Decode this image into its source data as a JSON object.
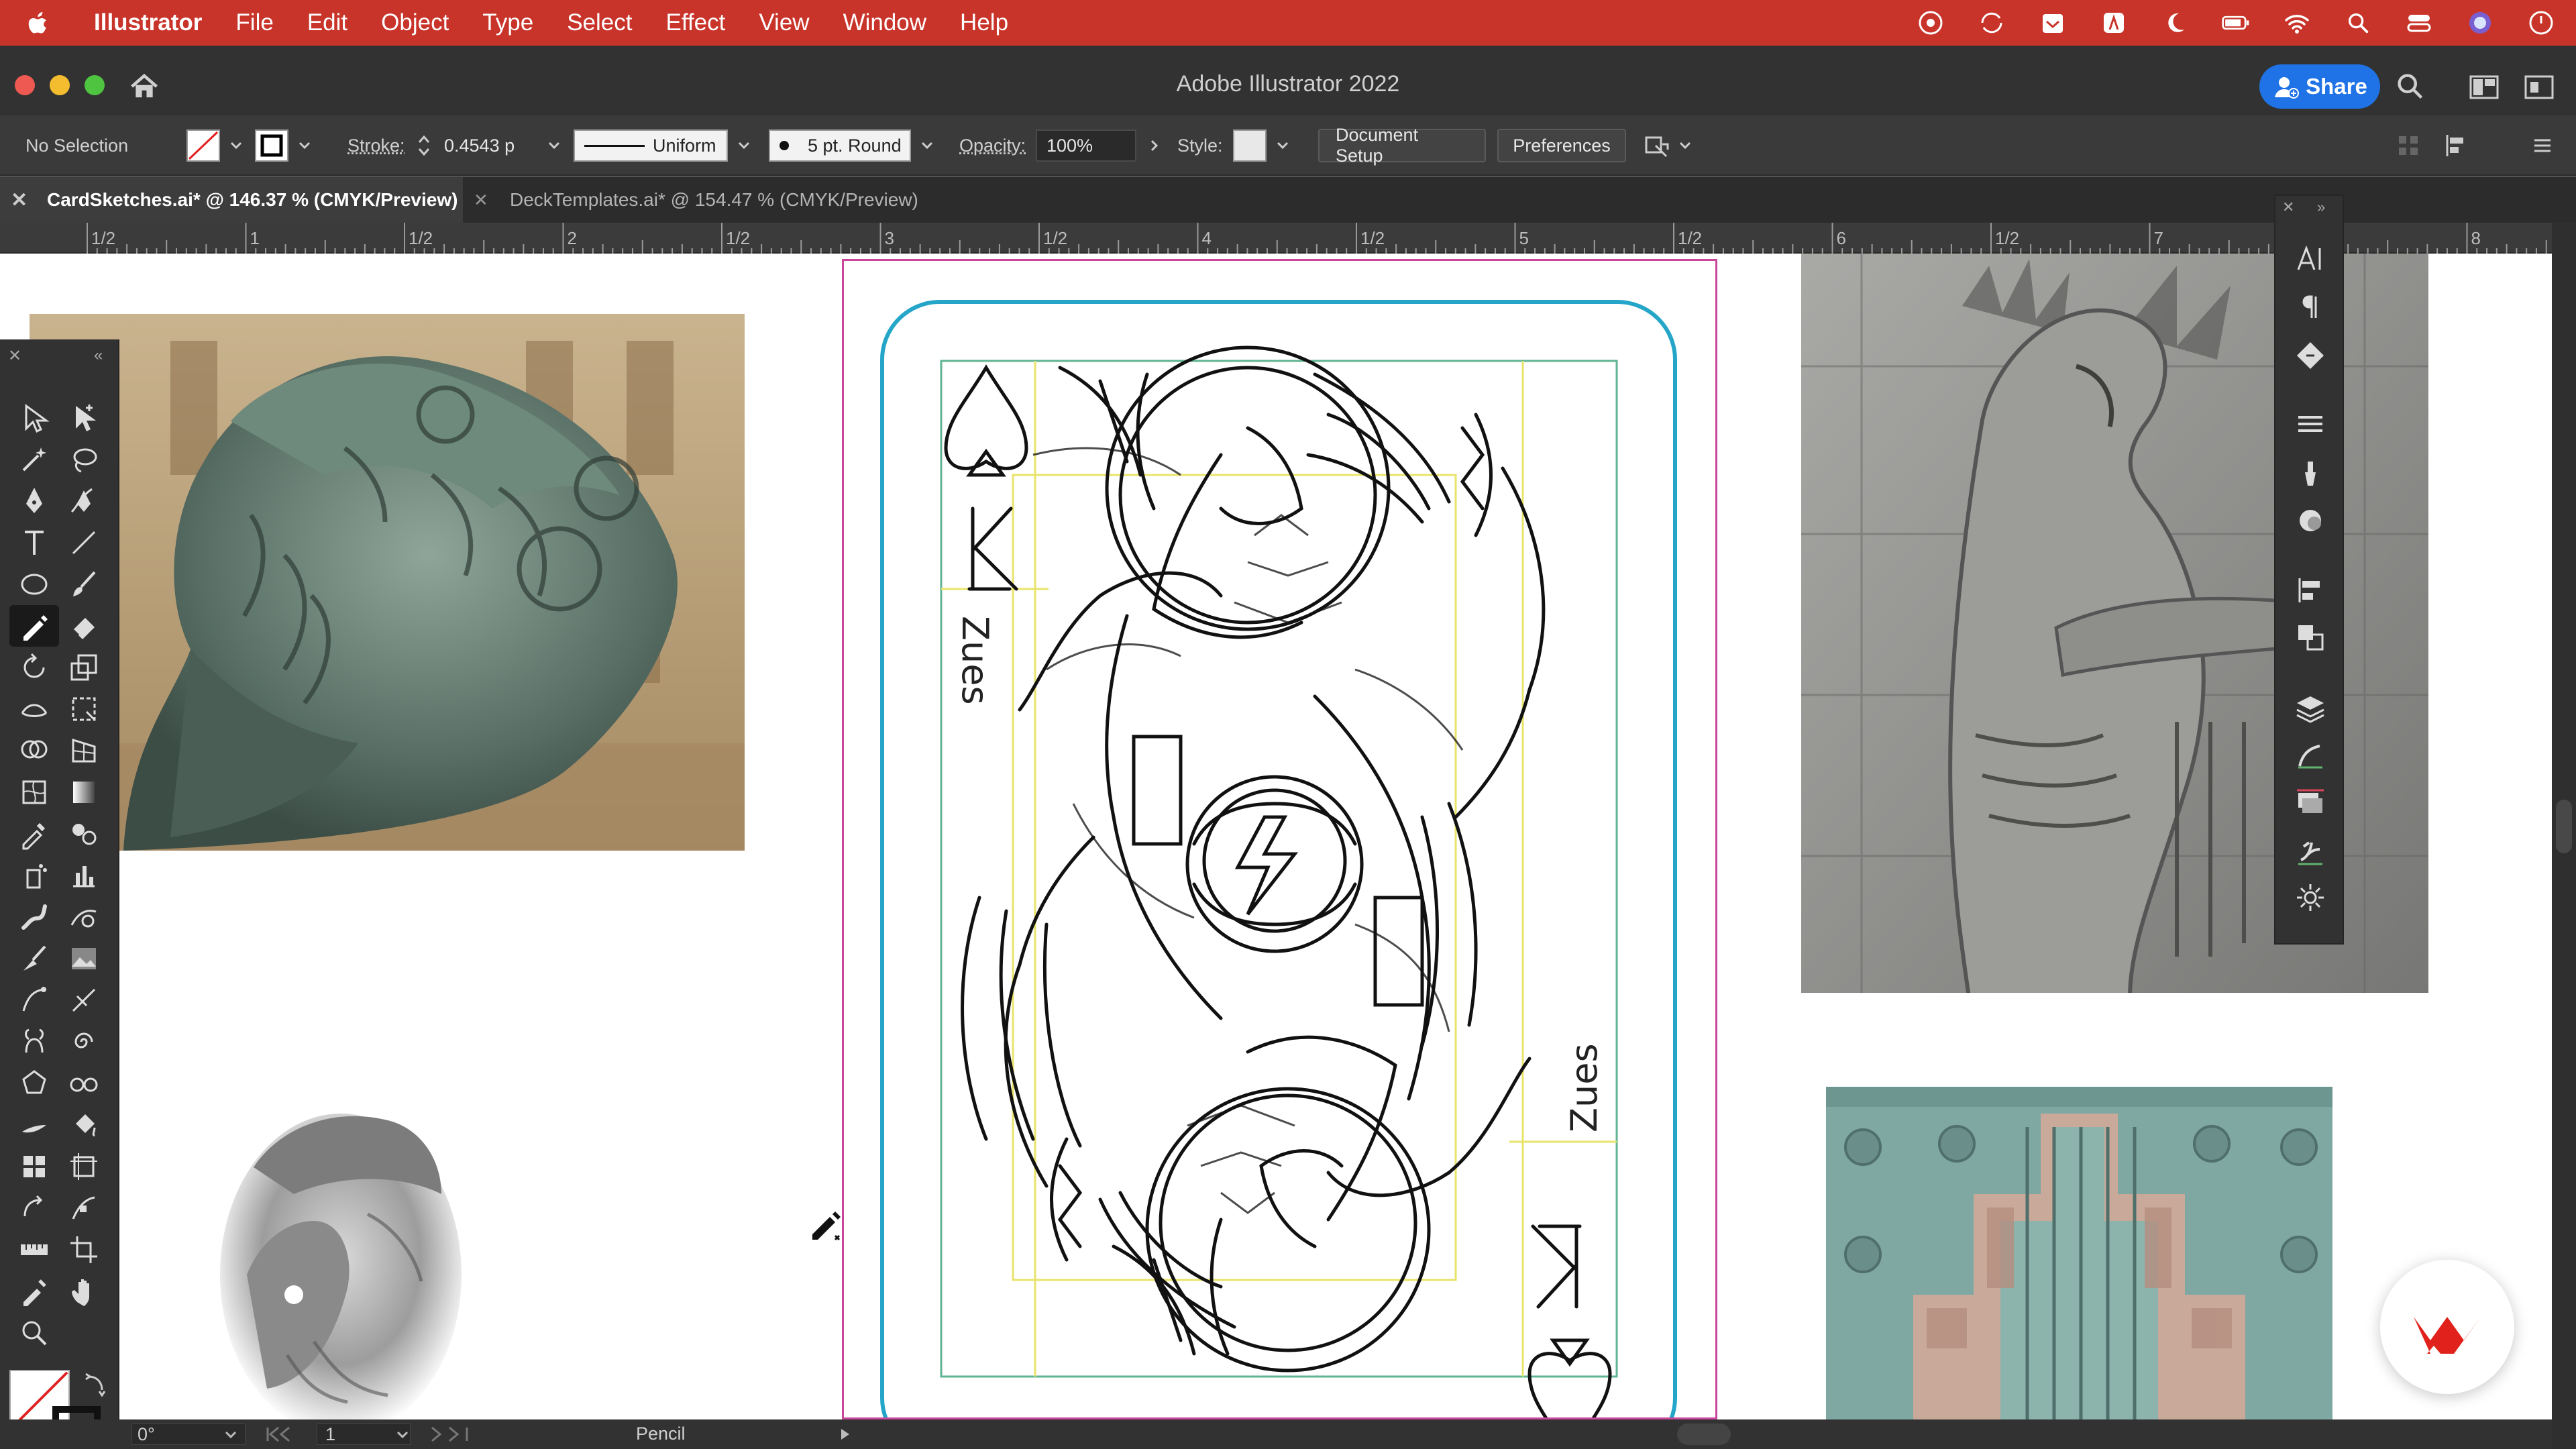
{
  "menubar": {
    "app_name": "Illustrator",
    "items": [
      "File",
      "Edit",
      "Object",
      "Type",
      "Select",
      "Effect",
      "View",
      "Window",
      "Help"
    ]
  },
  "window": {
    "title": "Adobe Illustrator 2022",
    "share_label": "Share"
  },
  "control_bar": {
    "selection_label": "No Selection",
    "stroke_label": "Stroke:",
    "stroke_value": "0.4543 p",
    "profile_value": "Uniform",
    "brush_value": "5 pt. Round",
    "opacity_label": "Opacity:",
    "opacity_value": "100%",
    "style_label": "Style:",
    "document_setup_label": "Document Setup",
    "preferences_label": "Preferences"
  },
  "tabs": [
    {
      "label": "CardSketches.ai* @ 146.37 % (CMYK/Preview)",
      "active": true
    },
    {
      "label": "DeckTemplates.ai* @ 154.47 % (CMYK/Preview)",
      "active": false
    }
  ],
  "ruler": {
    "labels": [
      "1/2",
      "1",
      "1/2",
      "2",
      "1/2",
      "3",
      "1/2",
      "4",
      "1/2",
      "5",
      "1/2",
      "6",
      "1/2",
      "7",
      "1/2",
      "8"
    ]
  },
  "artboard": {
    "card_text": "Zues",
    "card_rank": "K"
  },
  "status_bar": {
    "rotation_value": "0°",
    "artboard_number": "1",
    "tool_name": "Pencil"
  },
  "colors": {
    "menubar_bg": "#c9342a",
    "share_button": "#1f73e6",
    "card_border": "#25a6c9",
    "artboard_border": "#c8479a",
    "guide_green": "#5fb493",
    "guide_yellow": "#e8e46a"
  },
  "icons": [
    "apple-icon",
    "home-icon",
    "search-icon",
    "pencil-tool-icon",
    "hand-tool-icon",
    "zoom-tool-icon",
    "behance-icon"
  ]
}
